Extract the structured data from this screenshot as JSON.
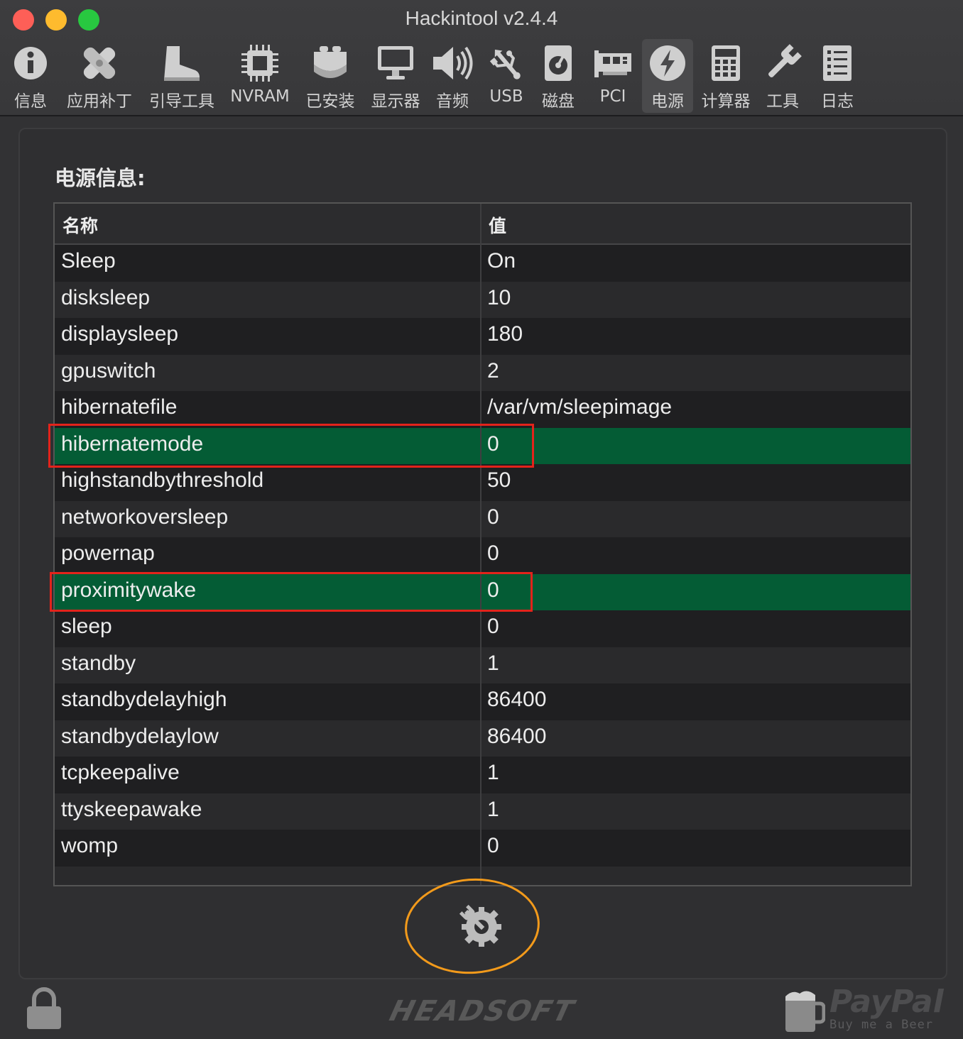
{
  "window": {
    "title": "Hackintool v2.4.4"
  },
  "toolbar": {
    "items": [
      {
        "label": "信息",
        "icon": "info-icon"
      },
      {
        "label": "应用补丁",
        "icon": "bandage-icon"
      },
      {
        "label": "引导工具",
        "icon": "boot-icon"
      },
      {
        "label": "NVRAM",
        "icon": "chip-icon"
      },
      {
        "label": "已安装",
        "icon": "lego-brick-icon"
      },
      {
        "label": "显示器",
        "icon": "monitor-icon"
      },
      {
        "label": "音频",
        "icon": "speaker-icon"
      },
      {
        "label": "USB",
        "icon": "usb-icon"
      },
      {
        "label": "磁盘",
        "icon": "disk-icon"
      },
      {
        "label": "PCI",
        "icon": "pci-card-icon"
      },
      {
        "label": "电源",
        "icon": "power-bolt-icon",
        "active": true
      },
      {
        "label": "计算器",
        "icon": "calculator-icon"
      },
      {
        "label": "工具",
        "icon": "wrench-icon"
      },
      {
        "label": "日志",
        "icon": "log-list-icon"
      }
    ]
  },
  "power": {
    "section_title": "电源信息:",
    "columns": {
      "name": "名称",
      "value": "值"
    },
    "rows": [
      {
        "name": "Sleep",
        "value": "On"
      },
      {
        "name": "disksleep",
        "value": "10"
      },
      {
        "name": "displaysleep",
        "value": "180"
      },
      {
        "name": "gpuswitch",
        "value": "2"
      },
      {
        "name": "hibernatefile",
        "value": "/var/vm/sleepimage"
      },
      {
        "name": "hibernatemode",
        "value": "0",
        "highlighted": true
      },
      {
        "name": "highstandbythreshold",
        "value": "50"
      },
      {
        "name": "networkoversleep",
        "value": "0"
      },
      {
        "name": "powernap",
        "value": "0"
      },
      {
        "name": "proximitywake",
        "value": "0",
        "highlighted": true
      },
      {
        "name": "sleep",
        "value": "0"
      },
      {
        "name": "standby",
        "value": "1"
      },
      {
        "name": "standbydelayhigh",
        "value": "86400"
      },
      {
        "name": "standbydelaylow",
        "value": "86400"
      },
      {
        "name": "tcpkeepalive",
        "value": "1"
      },
      {
        "name": "ttyskeepawake",
        "value": "1"
      },
      {
        "name": "womp",
        "value": "0"
      }
    ]
  },
  "footer": {
    "brand": "HEADSOFT",
    "paypal_word": "PayPal",
    "paypal_sub": "Buy me a Beer"
  },
  "colors": {
    "highlight_row": "#045c35",
    "annotation_red": "#e3231b",
    "annotation_orange": "#f29a1b"
  }
}
